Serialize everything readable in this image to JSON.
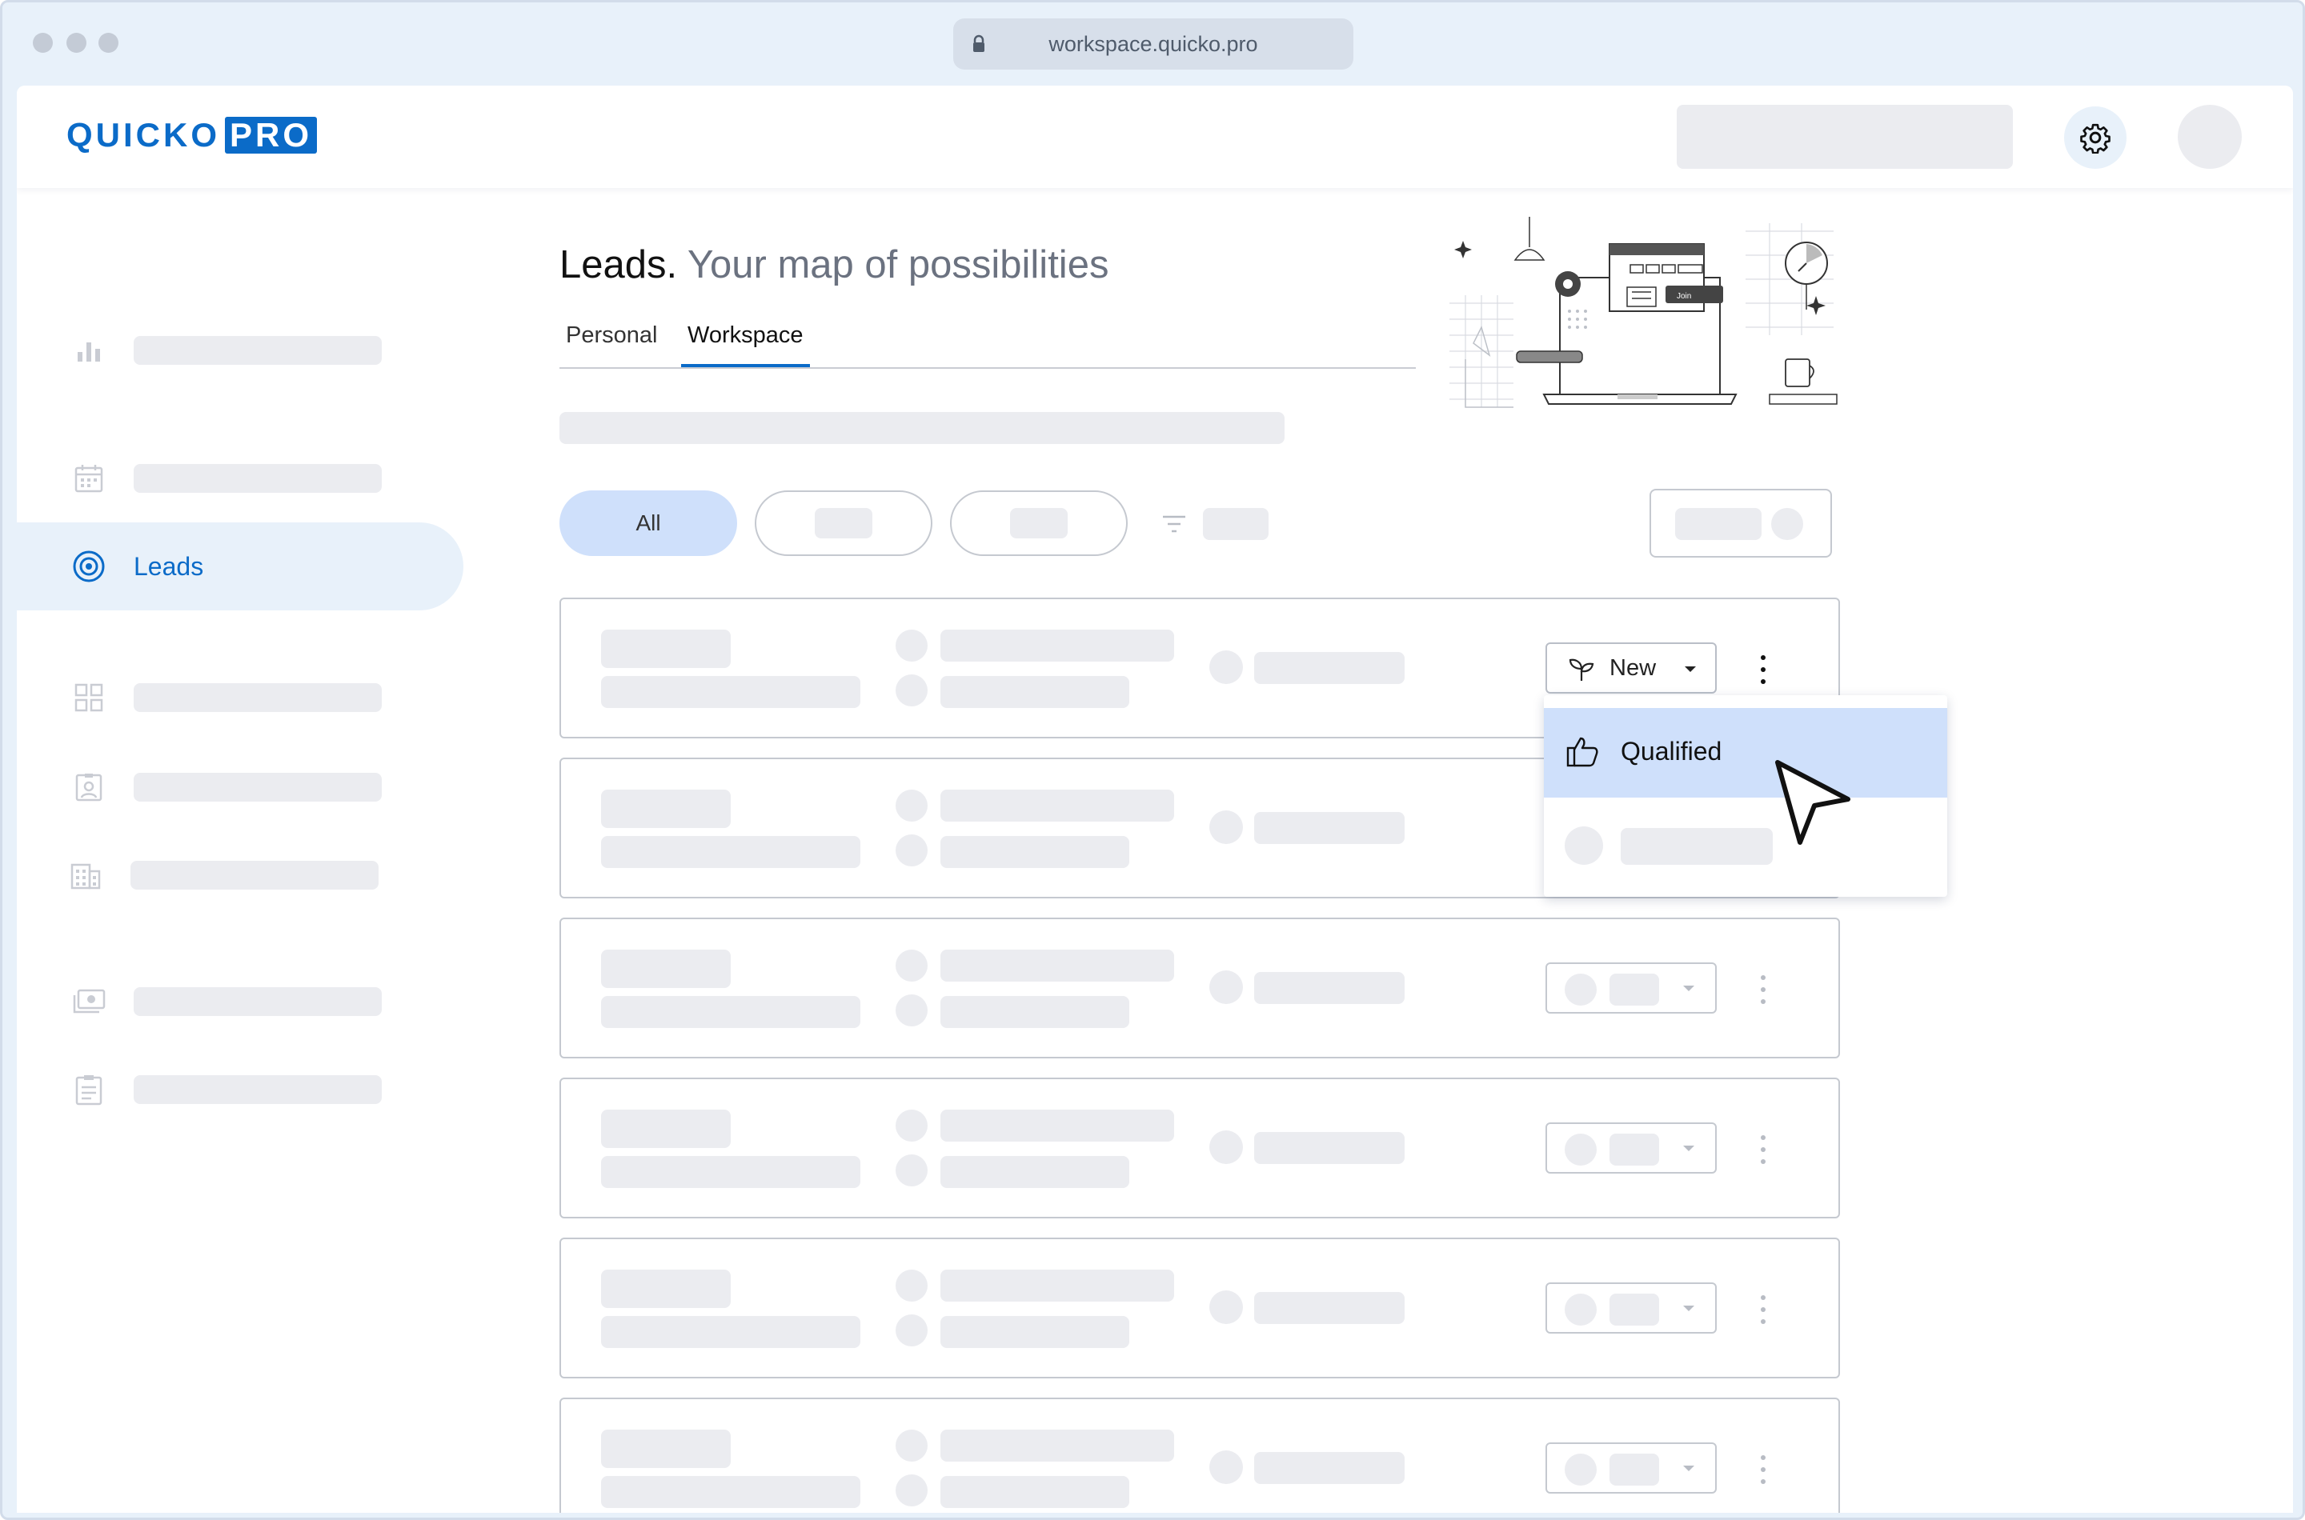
{
  "browser": {
    "url": "workspace.quicko.pro"
  },
  "header": {
    "logo_text": "QUICKO",
    "logo_badge": "PRO",
    "settings_icon": "gear-icon"
  },
  "sidebar": {
    "active_label": "Leads",
    "icons": [
      "bar-chart-icon",
      "calendar-icon",
      "target-icon",
      "grid-icon",
      "contact-card-icon",
      "building-icon",
      "money-icon",
      "clipboard-icon"
    ]
  },
  "main": {
    "title_strong": "Leads.",
    "title_soft": "Your map of possibilities",
    "tabs": [
      {
        "label": "Personal",
        "active": false
      },
      {
        "label": "Workspace",
        "active": true
      }
    ],
    "filter_chip_all": "All"
  },
  "first_row": {
    "status_label": "New"
  },
  "dropdown": {
    "highlighted_label": "Qualified"
  },
  "colors": {
    "accent": "#0b6bc8",
    "active_bg": "#e8f1fa",
    "highlight": "#cfe0fb",
    "placeholder": "#ebecf0"
  }
}
